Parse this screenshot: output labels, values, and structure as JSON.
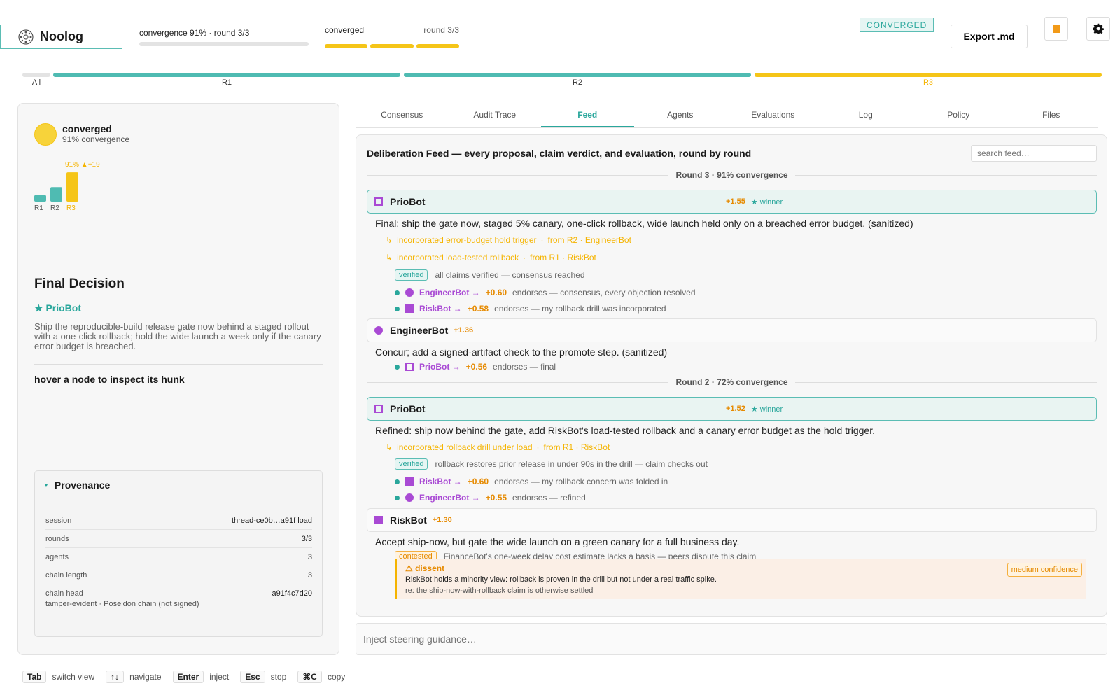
{
  "brand": {
    "name": "Noolog"
  },
  "header": {
    "convergence_text": "convergence 91% · round 3/3",
    "status_label": "converged",
    "round_label": "round 3/3",
    "status_badge": "CONVERGED",
    "export_label": "Export .md"
  },
  "rounds_bar": {
    "all_label": "All",
    "rounds": [
      {
        "label": "R1",
        "color": "#4fbbb2"
      },
      {
        "label": "R2",
        "color": "#4fbbb2"
      },
      {
        "label": "R3",
        "color": "#f5c518"
      }
    ]
  },
  "summary": {
    "status": "converged",
    "convergence_text": "91% convergence",
    "chart": {
      "peak_label": "91% ▲+19",
      "bars": [
        {
          "label": "R1",
          "value": 0.2,
          "color": "#4fbbb2"
        },
        {
          "label": "R2",
          "value": 0.45,
          "color": "#4fbbb2"
        },
        {
          "label": "R3",
          "value": 0.91,
          "color": "#f5c518"
        }
      ]
    },
    "final_decision_title": "Final Decision",
    "winner": "★ PrioBot",
    "decision_text": "Ship the reproducible-build release gate now behind a staged rollout with a one-click rollback; hold the wide launch a week only if the canary error budget is breached.",
    "hover_hint": "hover a node to inspect its hunk"
  },
  "provenance": {
    "title": "Provenance",
    "rows": [
      {
        "key": "session",
        "value": "thread-ce0b…a91f load"
      },
      {
        "key": "rounds",
        "value": "3/3"
      },
      {
        "key": "agents",
        "value": "3"
      },
      {
        "key": "chain length",
        "value": "3"
      },
      {
        "key": "chain head",
        "value": "a91f4c7d20"
      }
    ],
    "footnote": "tamper-evident · Poseidon chain (not signed)"
  },
  "tabs": [
    "Consensus",
    "Audit Trace",
    "Feed",
    "Agents",
    "Evaluations",
    "Log",
    "Policy",
    "Files"
  ],
  "active_tab": "Feed",
  "feed": {
    "title": "Deliberation Feed — every proposal, claim verdict, and evaluation, round by round",
    "search_placeholder": "search feed…",
    "round3": {
      "heading": "Round 3 · 91% convergence",
      "priobot": {
        "name": "PrioBot",
        "score": "+1.55",
        "winner": "★ winner",
        "text": "Final: ship the gate now, staged 5% canary, one-click rollback, wide launch held only on a breached error budget. (sanitized)",
        "incorporated": [
          {
            "text": "incorporated error-budget hold trigger",
            "from": "from R2 · EngineerBot"
          },
          {
            "text": "incorporated load-tested rollback",
            "from": "from R1 · RiskBot"
          }
        ],
        "verdict_pill": "verified",
        "verdict_text": "all claims verified — consensus reached",
        "endorsements": [
          {
            "agent": "EngineerBot →",
            "score": "+0.60",
            "text": "endorses — consensus, every objection resolved"
          },
          {
            "agent": "RiskBot →",
            "score": "+0.58",
            "text": "endorses — my rollback drill was incorporated"
          }
        ]
      },
      "engineerbot": {
        "name": "EngineerBot",
        "score": "+1.36",
        "text": "Concur; add a signed-artifact check to the promote step. (sanitized)",
        "endorsements": [
          {
            "agent": "PrioBot →",
            "score": "+0.56",
            "text": "endorses — final"
          }
        ]
      }
    },
    "round2": {
      "heading": "Round 2 · 72% convergence",
      "priobot": {
        "name": "PrioBot",
        "score": "+1.52",
        "winner": "★ winner",
        "text": "Refined: ship now behind the gate, add RiskBot's load-tested rollback and a canary error budget as the hold trigger.",
        "incorporated": [
          {
            "text": "incorporated rollback drill under load",
            "from": "from R1 · RiskBot"
          }
        ],
        "verdict_pill": "verified",
        "verdict_text": "rollback restores prior release in under 90s in the drill — claim checks out",
        "endorsements": [
          {
            "agent": "RiskBot →",
            "score": "+0.60",
            "text": "endorses — my rollback concern was folded in"
          },
          {
            "agent": "EngineerBot →",
            "score": "+0.55",
            "text": "endorses — refined"
          }
        ]
      },
      "riskbot": {
        "name": "RiskBot",
        "score": "+1.30",
        "text": "Accept ship-now, but gate the wide launch on a green canary for a full business day.",
        "verdict_pill": "contested",
        "verdict_text": "FinanceBot's one-week delay cost estimate lacks a basis — peers dispute this claim",
        "dissent": {
          "title": "⚠ dissent",
          "confidence": "medium confidence",
          "text": "RiskBot holds a minority view: rollback is proven in the drill but not under a real traffic spike.",
          "re": "re: the ship-now-with-rollback claim is otherwise settled"
        }
      }
    }
  },
  "steer_placeholder": "Inject steering guidance…",
  "shortcuts": [
    {
      "key": "Tab",
      "label": "switch view"
    },
    {
      "key": "↑↓",
      "label": "navigate"
    },
    {
      "key": "Enter",
      "label": "inject"
    },
    {
      "key": "Esc",
      "label": "stop"
    },
    {
      "key": "⌘C",
      "label": "copy"
    }
  ],
  "colors": {
    "accent": "#2aa79c",
    "warning": "#f5c518",
    "agent": "#a94ad4",
    "score": "#e68a00"
  }
}
